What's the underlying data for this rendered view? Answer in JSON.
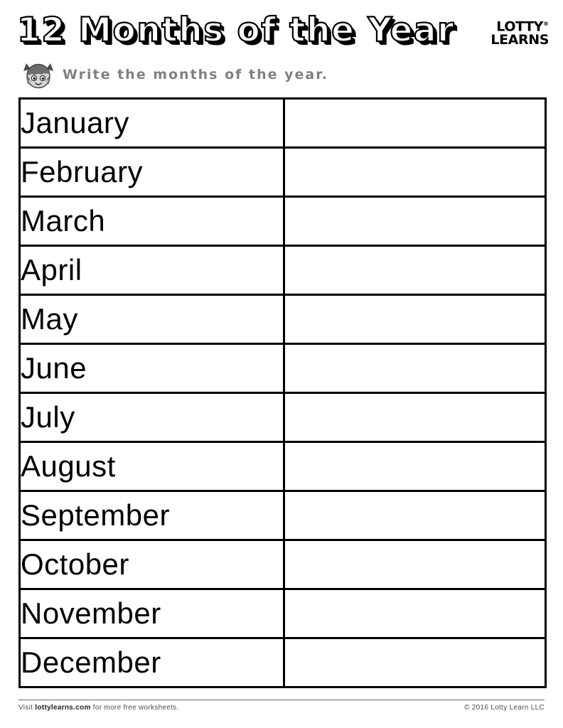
{
  "header": {
    "title": "12 Months of the Year",
    "logo": {
      "line1": "LOTTY",
      "line2": "LEARNS",
      "trademark": "®"
    }
  },
  "instruction": {
    "mascot_icon": "girl-face-icon",
    "text": "Write the months of the year."
  },
  "table": {
    "rows": [
      {
        "month": "January",
        "answer": ""
      },
      {
        "month": "February",
        "answer": ""
      },
      {
        "month": "March",
        "answer": ""
      },
      {
        "month": "April",
        "answer": ""
      },
      {
        "month": "May",
        "answer": ""
      },
      {
        "month": "June",
        "answer": ""
      },
      {
        "month": "July",
        "answer": ""
      },
      {
        "month": "August",
        "answer": ""
      },
      {
        "month": "September",
        "answer": ""
      },
      {
        "month": "October",
        "answer": ""
      },
      {
        "month": "November",
        "answer": ""
      },
      {
        "month": "December",
        "answer": ""
      }
    ]
  },
  "footer": {
    "visit_prefix": "Visit ",
    "site": "lottylearns.com",
    "visit_suffix": " for more free worksheets.",
    "copyright": "© 2016 Lotty Learn LLC"
  },
  "colors": {
    "ink": "#000000",
    "subtitle_grey": "#808080",
    "footer_grey": "#4d4d4d",
    "paper": "#ffffff"
  }
}
